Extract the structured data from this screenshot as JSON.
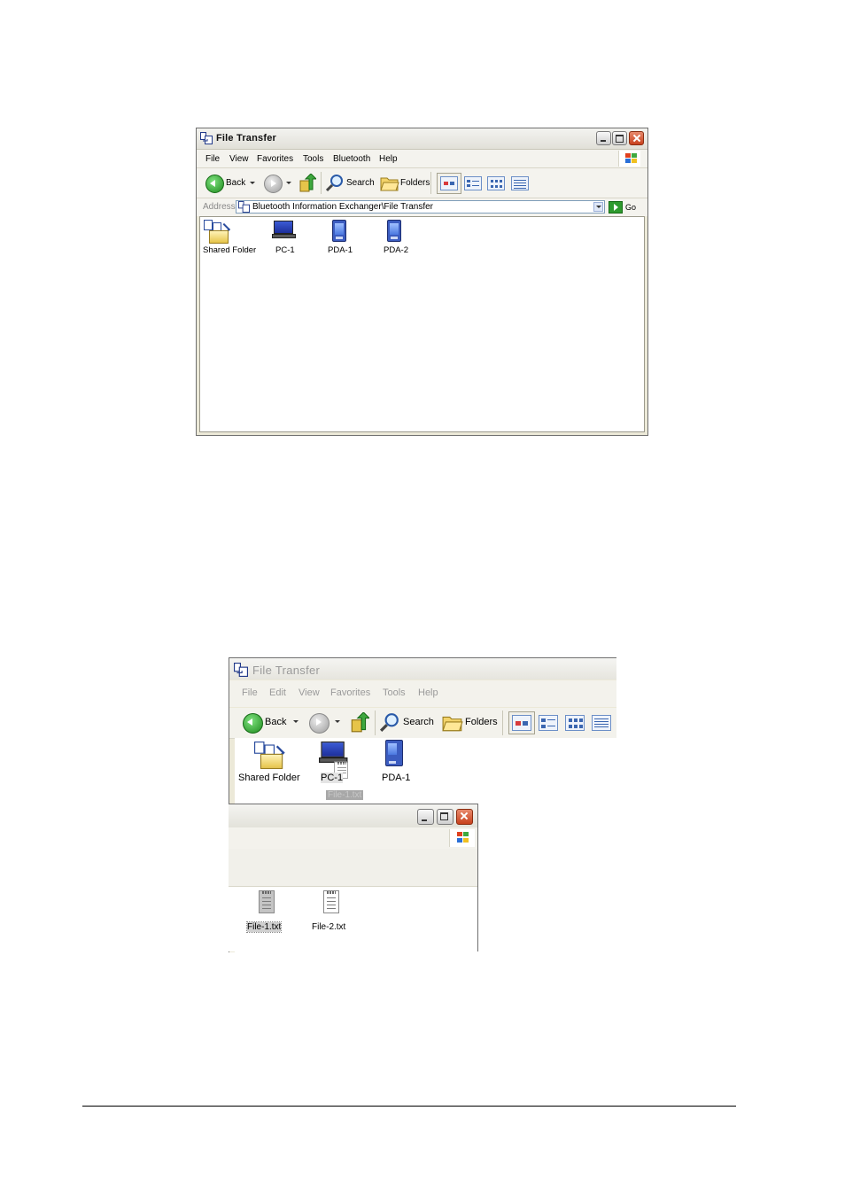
{
  "window1": {
    "title": "File Transfer",
    "menu": [
      "File",
      "View",
      "Favorites",
      "Tools",
      "Bluetooth",
      "Help"
    ],
    "toolbar": {
      "back": "Back",
      "search": "Search",
      "folders": "Folders"
    },
    "address": {
      "label": "Address",
      "value": "Bluetooth Information Exchanger\\File Transfer",
      "go": "Go"
    },
    "items": [
      "Shared Folder",
      "PC-1",
      "PDA-1",
      "PDA-2"
    ]
  },
  "window2": {
    "title": "File Transfer",
    "menu": [
      "File",
      "Edit",
      "View",
      "Favorites",
      "Tools",
      "Help"
    ],
    "toolbar": {
      "back": "Back",
      "search": "Search",
      "folders": "Folders"
    },
    "items": [
      "Shared Folder",
      "PC-1",
      "PDA-1"
    ],
    "drag_label": "File-1.txt"
  },
  "window3": {
    "files": [
      "File-1.txt",
      "File-2.txt"
    ]
  },
  "colors": {
    "xp_title_blue": "#0a246a",
    "close_red": "#c8411d",
    "go_green": "#2e9a2e",
    "folder_yellow": "#e6c44a"
  }
}
